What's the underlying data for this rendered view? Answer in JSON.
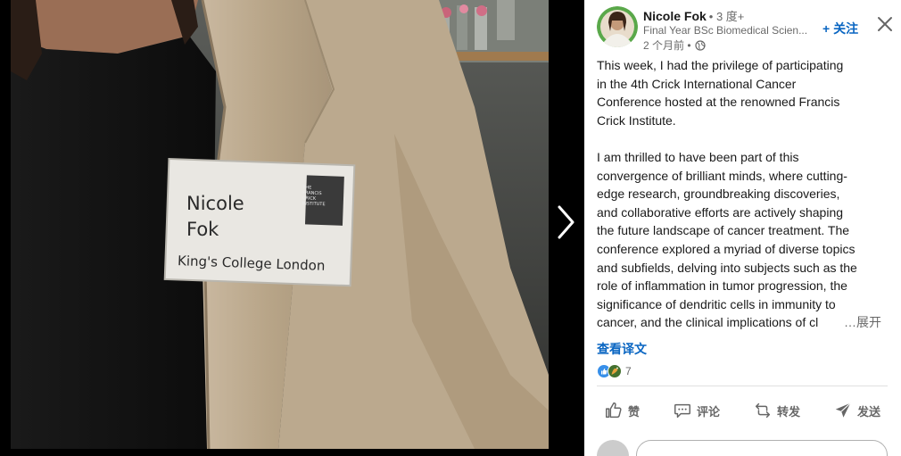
{
  "photo": {
    "badge": {
      "name_line1": "Nicole",
      "name_line2": "Fok",
      "affiliation": "King's College London",
      "logo_lines": [
        "THE",
        "FRANCIS",
        "CRICK",
        "INSTITUTE"
      ]
    },
    "next_icon": "chevron-right-icon"
  },
  "post": {
    "author": {
      "name": "Nicole Fok",
      "degree": "• 3 度+",
      "headline": "Final Year BSc Biomedical Scien...",
      "time": "2 个月前 •",
      "visibility_icon": "globe-icon",
      "avatar_ring_color": "#5aa84a"
    },
    "follow_label": "+ 关注",
    "close_icon": "close-icon",
    "paragraph1": [
      "This week, I had the privilege of participating",
      "in the 4th Crick International Cancer",
      "Conference hosted at the renowned Francis",
      "Crick Institute."
    ],
    "paragraph2": [
      "I am thrilled to have been part of this",
      "convergence of brilliant minds, where cutting-",
      "edge research, groundbreaking discoveries,",
      "and collaborative efforts are actively shaping",
      "the future landscape of cancer treatment. The",
      "conference explored a myriad of diverse topics",
      "and subfields, delving into subjects such as the",
      "role of inflammation in tumor progression, the",
      "significance of dendritic cells in immunity to",
      "cancer, and the clinical implications of cl"
    ],
    "see_more": "…展开",
    "translate": "查看译文",
    "reaction_count": "7",
    "actions": {
      "like": "赞",
      "comment": "评论",
      "repost": "转发",
      "send": "发送"
    },
    "colors": {
      "link_blue": "#0a66c2",
      "like_blue": "#378fe9",
      "celebrate_green": "#44712e"
    }
  }
}
